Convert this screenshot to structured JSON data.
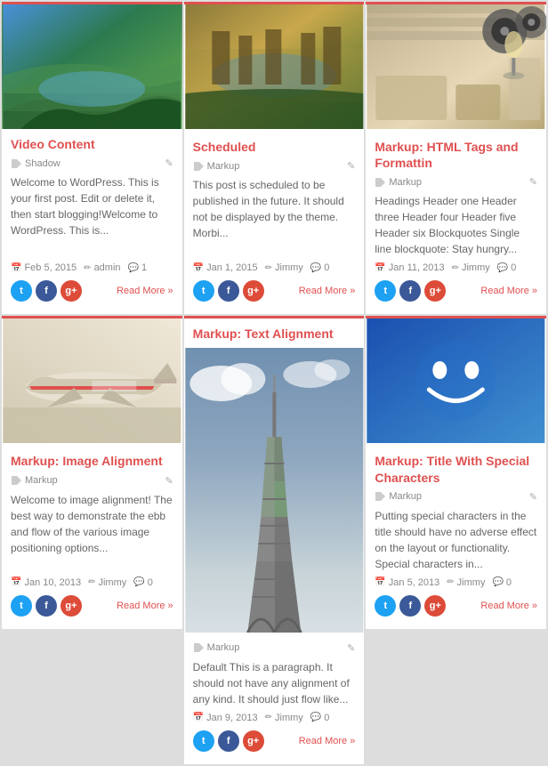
{
  "cards": [
    {
      "id": "video-content",
      "title": "Video Content",
      "tag": "Shadow",
      "excerpt": "Welcome to WordPress. This is your first post. Edit or delete it, then start blogging!Welcome to WordPress. This is...",
      "date": "Feb 5, 2015",
      "author": "admin",
      "comments": "1",
      "readMore": "Read More »",
      "imageType": "terraced"
    },
    {
      "id": "scheduled",
      "title": "Scheduled",
      "tag": "Markup",
      "excerpt": "This post is scheduled to be published in the future. It should not be displayed by the theme. Morbi...",
      "date": "Jan 1, 2015",
      "author": "Jimmy",
      "comments": "0",
      "readMore": "Read More »",
      "imageType": "river"
    },
    {
      "id": "markup-html",
      "title": "Markup: HTML Tags and Formattin",
      "tag": "Markup",
      "excerpt": "Headings Header one Header three Header four Header five Header six Blockquotes Single line blockquote: Stay hungry...",
      "date": "Jan 11, 2013",
      "author": "Jimmy",
      "comments": "0",
      "readMore": "Read More »",
      "imageType": "filmreel"
    },
    {
      "id": "image-alignment",
      "title": "Markup: Image Alignment",
      "tag": "Markup",
      "excerpt": "Welcome to image alignment! The best way to demonstrate the ebb and flow of the various image positioning options...",
      "date": "Jan 10, 2013",
      "author": "Jimmy",
      "comments": "0",
      "readMore": "Read More »",
      "imageType": "airplane"
    },
    {
      "id": "text-alignment",
      "title": "Markup: Text Alignment",
      "tag": "Markup",
      "excerpt": "Default This is a paragraph. It should not have any alignment of any kind. It should just flow like...",
      "date": "Jan 9, 2013",
      "author": "Jimmy",
      "comments": "0",
      "readMore": "Read More »",
      "imageType": "eiffel"
    },
    {
      "id": "title-special",
      "title": "Markup: Title With Special Characters",
      "tag": "Markup",
      "excerpt": "Putting special characters in the title should have no adverse effect on the layout or functionality. Special characters in...",
      "date": "Jan 5, 2013",
      "author": "Jimmy",
      "comments": "0",
      "readMore": "Read More »",
      "imageType": "smiley"
    }
  ],
  "social": {
    "twitter": "t",
    "facebook": "f",
    "googleplus": "g+"
  }
}
